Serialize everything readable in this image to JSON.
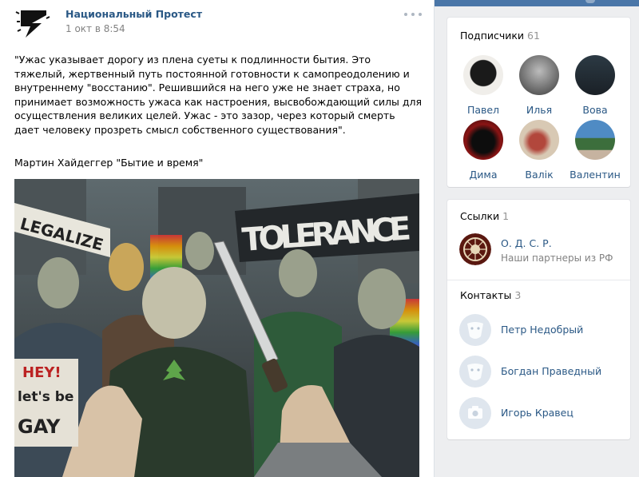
{
  "colors": {
    "link": "#2a5885",
    "muted": "#828282",
    "header_bar": "#4a76a8",
    "background": "#edeef0"
  },
  "post": {
    "author": "Национальный Протест",
    "date": "1 окт в 8:54",
    "more_icon": "ellipsis-icon",
    "text": "\"Ужас указывает дорогу из плена суеты к подлинности бытия. Это тяжелый, жертвенный путь постоянной готовности к самопреодолению и внутреннему \"восстанию\". Решившийся на него уже не знает страха, но принимает возможность ужаса как настроения, высвобождающий силы для осуществления великих целей. Ужас - это зазор, через который смерть дает человеку прозреть смысл собственного существования\".",
    "signature": "Мартин Хайдеггер \"Бытие и время\"",
    "image": {
      "sign_left": "LEGALIZE",
      "sign_main": "TOLERANCE",
      "sign_hey": "HEY!",
      "sign_lets": "let's be",
      "sign_gay": "GAY"
    }
  },
  "friends": {
    "title": "Подписчики",
    "count": "61",
    "items": [
      {
        "name": "Павел"
      },
      {
        "name": "Илья"
      },
      {
        "name": "Вова"
      },
      {
        "name": "Дима"
      },
      {
        "name": "Валік"
      },
      {
        "name": "Валентин"
      }
    ]
  },
  "links": {
    "title": "Ссылки",
    "count": "1",
    "items": [
      {
        "name": "О. Д. С. Р.",
        "desc": "Наши партнеры из РФ"
      }
    ]
  },
  "contacts": {
    "title": "Контакты",
    "count": "3",
    "items": [
      {
        "name": "Петр Недобрый",
        "icon": "default-avatar-icon"
      },
      {
        "name": "Богдан Праведный",
        "icon": "default-avatar-icon"
      },
      {
        "name": "Игорь Кравец",
        "icon": "camera-icon"
      }
    ]
  }
}
